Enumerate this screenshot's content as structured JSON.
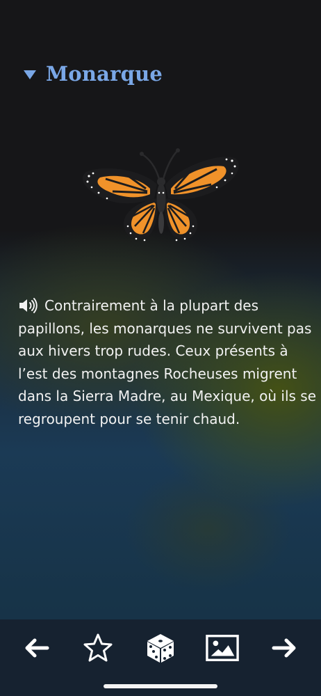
{
  "header": {
    "title": "Monarque",
    "toggle_icon": "disclosure-triangle-down-icon",
    "accent_color": "#7aa7e6"
  },
  "illustration": {
    "subject": "monarch-butterfly",
    "wing_color": "#f0922a",
    "vein_color": "#1c1c1e"
  },
  "description": {
    "audio_icon": "speaker-icon",
    "text": "Contrairement à la plupart des papillons, les monarques ne survivent pas aux hivers trop rudes. Ceux présents à l’est des montagnes Rocheuses migrent dans la Sierra Madre, au Mexique, où ils se regroupent pour se tenir chaud."
  },
  "toolbar": {
    "items": [
      {
        "icon": "arrow-left-icon"
      },
      {
        "icon": "star-icon"
      },
      {
        "icon": "dice-icon"
      },
      {
        "icon": "image-icon"
      },
      {
        "icon": "arrow-right-icon"
      }
    ],
    "background": "#162230"
  }
}
